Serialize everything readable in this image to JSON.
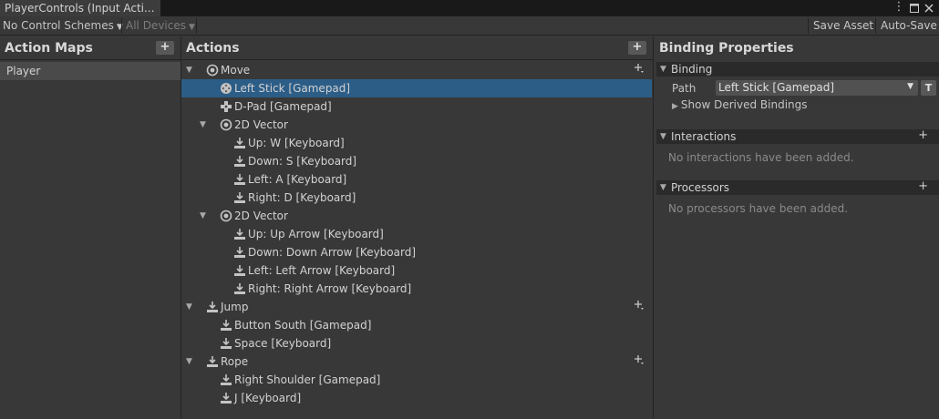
{
  "window": {
    "tab_title": "PlayerControls (Input Acti...",
    "menu_glyph": "⋮",
    "maximize_glyph": "□",
    "close_glyph": "✕"
  },
  "toolbar": {
    "control_schemes": "No Control Schemes",
    "devices": "All Devices",
    "save_asset": "Save Asset",
    "auto_save": "Auto-Save"
  },
  "action_maps": {
    "title": "Action Maps",
    "add": "+",
    "items": [
      "Player"
    ]
  },
  "actions": {
    "title": "Actions",
    "add": "+",
    "rows": [
      {
        "label": "Move"
      },
      {
        "label": "Left Stick [Gamepad]"
      },
      {
        "label": "D-Pad [Gamepad]"
      },
      {
        "label": "2D Vector"
      },
      {
        "label": "Up: W [Keyboard]"
      },
      {
        "label": "Down: S [Keyboard]"
      },
      {
        "label": "Left: A [Keyboard]"
      },
      {
        "label": "Right: D [Keyboard]"
      },
      {
        "label": "2D Vector"
      },
      {
        "label": "Up: Up Arrow [Keyboard]"
      },
      {
        "label": "Down: Down Arrow [Keyboard]"
      },
      {
        "label": "Left: Left Arrow [Keyboard]"
      },
      {
        "label": "Right: Right Arrow [Keyboard]"
      },
      {
        "label": "Jump"
      },
      {
        "label": "Button South [Gamepad]"
      },
      {
        "label": "Space [Keyboard]"
      },
      {
        "label": "Rope"
      },
      {
        "label": "Right Shoulder [Gamepad]"
      },
      {
        "label": "J [Keyboard]"
      }
    ]
  },
  "binding_properties": {
    "title": "Binding Properties",
    "binding_section": "Binding",
    "path_label": "Path",
    "path_value": "Left Stick [Gamepad]",
    "t_button": "T",
    "show_derived": "Show Derived Bindings",
    "interactions_section": "Interactions",
    "interactions_empty": "No interactions have been added.",
    "processors_section": "Processors",
    "processors_empty": "No processors have been added."
  },
  "colors": {
    "selection": "#2c5d87",
    "panel_bg": "#383838",
    "header_bg": "#191919"
  }
}
